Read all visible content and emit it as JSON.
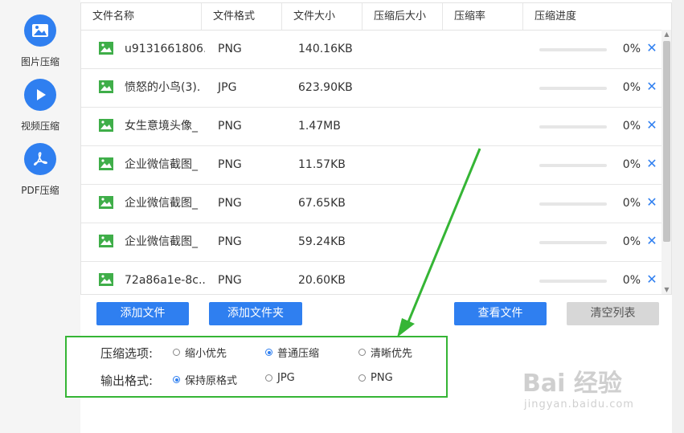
{
  "sidebar": {
    "items": [
      {
        "label": "图片压缩",
        "icon": "image-icon"
      },
      {
        "label": "视频压缩",
        "icon": "play-icon"
      },
      {
        "label": "PDF压缩",
        "icon": "pdf-icon"
      }
    ]
  },
  "table": {
    "headers": [
      "文件名称",
      "文件格式",
      "文件大小",
      "压缩后大小",
      "压缩率",
      "压缩进度"
    ],
    "rows": [
      {
        "name": "u9131661806...",
        "format": "PNG",
        "size": "140.16KB",
        "progress": 0,
        "progress_text": "0%"
      },
      {
        "name": "愤怒的小鸟(3).",
        "format": "JPG",
        "size": "623.90KB",
        "progress": 0,
        "progress_text": "0%"
      },
      {
        "name": "女生意境头像_",
        "format": "PNG",
        "size": "1.47MB",
        "progress": 0,
        "progress_text": "0%"
      },
      {
        "name": "企业微信截图_",
        "format": "PNG",
        "size": "11.57KB",
        "progress": 0,
        "progress_text": "0%"
      },
      {
        "name": "企业微信截图_",
        "format": "PNG",
        "size": "67.65KB",
        "progress": 0,
        "progress_text": "0%"
      },
      {
        "name": "企业微信截图_",
        "format": "PNG",
        "size": "59.24KB",
        "progress": 0,
        "progress_text": "0%"
      },
      {
        "name": "72a86a1e-8c...",
        "format": "PNG",
        "size": "20.60KB",
        "progress": 0,
        "progress_text": "0%"
      }
    ],
    "delete_glyph": "✕"
  },
  "buttons": {
    "add_file": "添加文件",
    "add_folder": "添加文件夹",
    "view_files": "查看文件",
    "clear_list": "清空列表"
  },
  "options": {
    "compress_label": "压缩选项:",
    "compress_choices": [
      {
        "label": "缩小优先",
        "selected": false
      },
      {
        "label": "普通压缩",
        "selected": true
      },
      {
        "label": "清晰优先",
        "selected": false
      }
    ],
    "output_label": "输出格式:",
    "output_choices": [
      {
        "label": "保持原格式",
        "selected": true
      },
      {
        "label": "JPG",
        "selected": false
      },
      {
        "label": "PNG",
        "selected": false
      }
    ]
  },
  "colors": {
    "accent": "#2f7ff0",
    "highlight_box": "#35b535",
    "image_icon": "#3fae49"
  },
  "watermark": {
    "text": "Bai 经验",
    "sub": "jingyan.baidu.com"
  }
}
